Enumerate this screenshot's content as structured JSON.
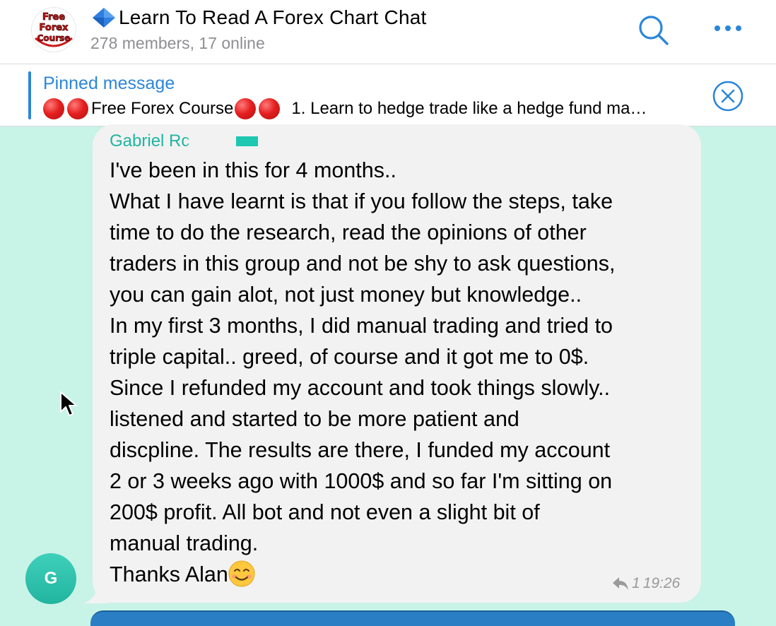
{
  "header": {
    "logo_lines": [
      "Free",
      "Forex",
      "Course"
    ],
    "title": "Learn To Read A Forex Chart Chat",
    "subtitle": "278 members, 17 online",
    "icons": {
      "search": "search-icon",
      "more": "more-icon",
      "diamond": "blue-diamond-icon"
    }
  },
  "pinned": {
    "label": "Pinned message",
    "text_main": "Free Forex Course",
    "text_rest": "1. Learn to hedge trade like a hedge fund ma…",
    "close_icon": "close-circle-icon"
  },
  "message": {
    "sender": "Gabriel Rc",
    "lines": [
      "I've been in this for 4 months..",
      "What I have learnt is that if you follow the steps, take",
      "time to do the  research, read the opinions of other",
      "traders in this group and not be shy to ask questions,",
      "you can gain alot, not just money but knowledge..",
      "In my first 3 months, I did manual trading and tried to",
      "triple capital.. greed, of course and it got me to 0$.",
      "Since I refunded my account and took things slowly..",
      "listened and started to be more patient and",
      "discpline. The results are there, I funded my account",
      "2 or 3 weeks ago with 1000$ and so far I'm sitting on",
      "200$ profit. All bot and not even a slight bit of",
      "manual trading."
    ],
    "last_line": "Thanks Alan",
    "reply_count": "1",
    "time": "19:26"
  },
  "avatar": {
    "initial": "G"
  },
  "colors": {
    "accent": "#2c86d8",
    "sender": "#1fb5a0",
    "chat_bg": "#c8f3e7",
    "bubble": "#f2f2f2",
    "avatar": "#21b49f"
  }
}
